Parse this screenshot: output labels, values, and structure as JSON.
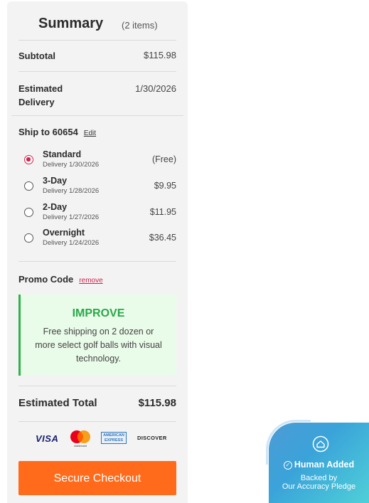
{
  "summary": {
    "title": "Summary",
    "count": "(2 items)"
  },
  "subtotal": {
    "label": "Subtotal",
    "value": "$115.98"
  },
  "delivery": {
    "label_line1": "Estimated",
    "label_line2": "Delivery",
    "value": "1/30/2026"
  },
  "ship_to": {
    "label": "Ship to 60654",
    "edit": "Edit"
  },
  "shipping_options": [
    {
      "name": "Standard",
      "date": "Delivery 1/30/2026",
      "price": "(Free)",
      "selected": true
    },
    {
      "name": "3-Day",
      "date": "Delivery 1/28/2026",
      "price": "$9.95",
      "selected": false
    },
    {
      "name": "2-Day",
      "date": "Delivery 1/27/2026",
      "price": "$11.95",
      "selected": false
    },
    {
      "name": "Overnight",
      "date": "Delivery 1/24/2026",
      "price": "$36.45",
      "selected": false
    }
  ],
  "promo": {
    "label": "Promo Code",
    "remove": "remove",
    "code": "IMPROVE",
    "description": "Free shipping on 2 dozen or more select golf balls with visual technology."
  },
  "total": {
    "label": "Estimated Total",
    "value": "$115.98"
  },
  "payment_icons": {
    "visa": "VISA",
    "mastercard": "mastercard",
    "amex_line1": "AMERICAN",
    "amex_line2": "EXPRESS",
    "discover": "DISCOVER"
  },
  "checkout": {
    "label": "Secure Checkout"
  },
  "badge": {
    "title": "Human Added",
    "line1": "Backed by",
    "line2": "Our Accuracy Pledge"
  },
  "colors": {
    "accent": "#ff6b1a",
    "radio_selected": "#d0234a",
    "promo_green": "#2aa84a"
  }
}
